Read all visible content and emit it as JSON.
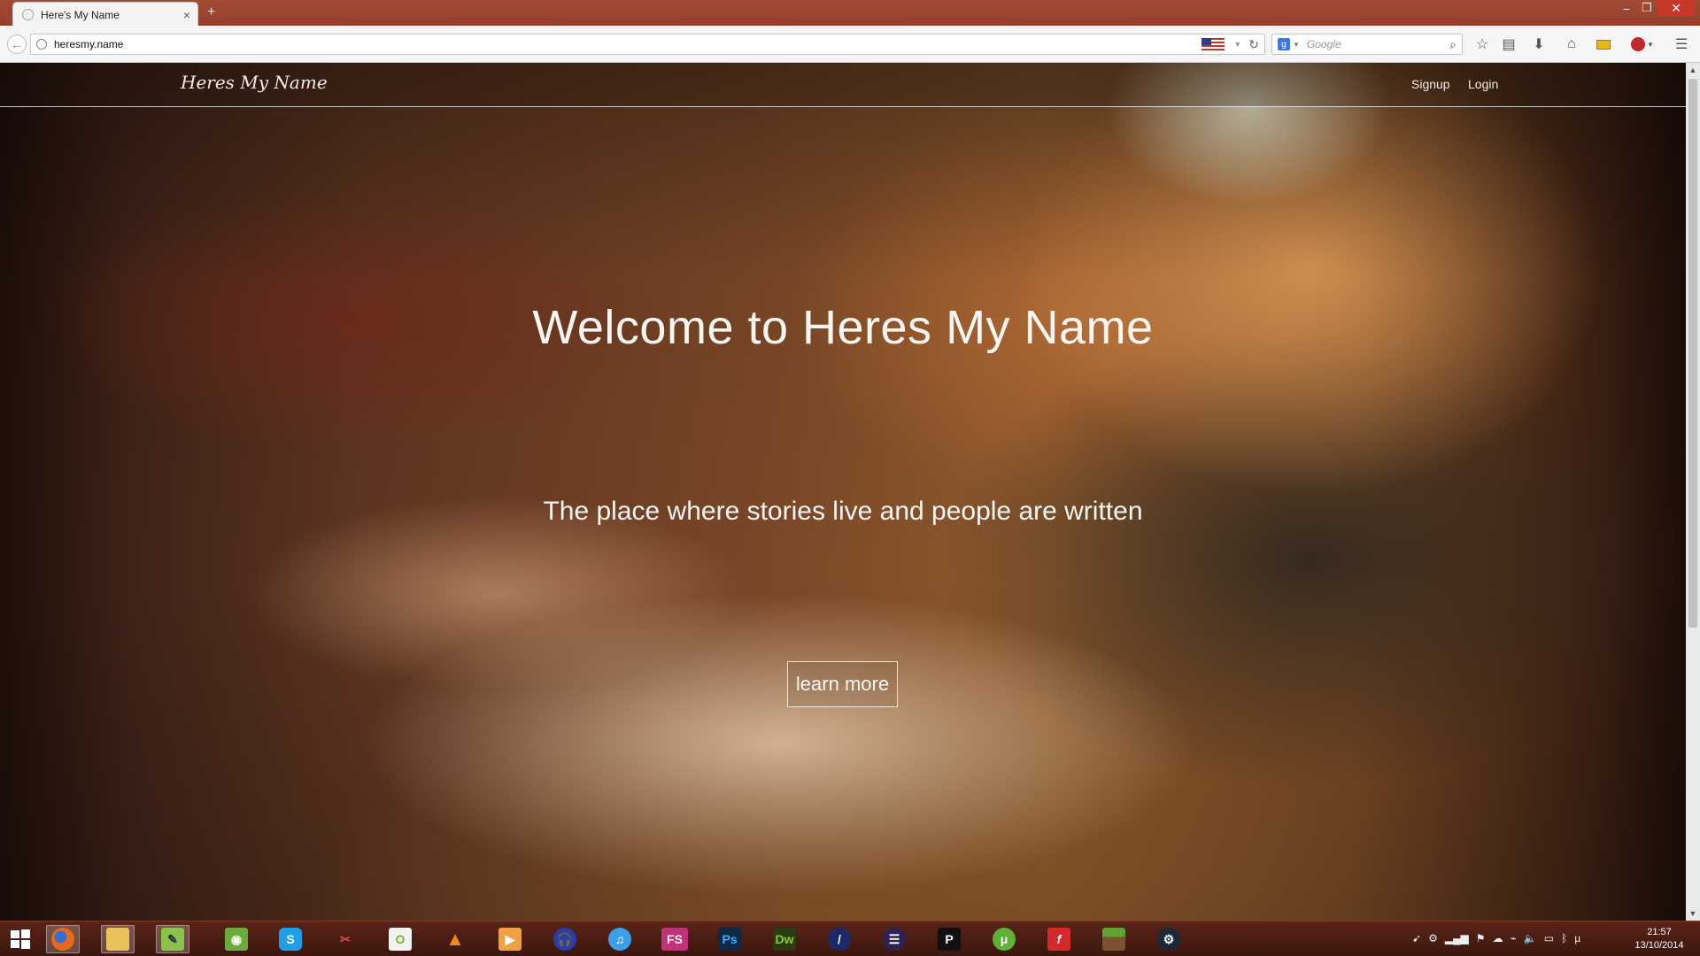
{
  "browser": {
    "tab_title": "Here's My Name",
    "tab_close": "×",
    "new_tab": "+",
    "url": "heresmy.name",
    "search_placeholder": "Google",
    "window_controls": {
      "minimize": "–",
      "maximize": "❐",
      "close": "✕"
    },
    "toolbar_icons": [
      "back-icon",
      "star-icon",
      "reading-list-icon",
      "download-icon",
      "home-icon",
      "addon-icon",
      "abp-icon",
      "menu-icon"
    ]
  },
  "site": {
    "brand": "Heres My Name",
    "nav": {
      "signup": "Signup",
      "login": "Login"
    },
    "hero": {
      "title": "Welcome to Heres My Name",
      "subtitle": "The place where stories live and people are written",
      "button": "learn more"
    }
  },
  "taskbar": {
    "apps": [
      {
        "name": "firefox",
        "label": ""
      },
      {
        "name": "file-explorer",
        "label": ""
      },
      {
        "name": "notepad",
        "label": ""
      },
      {
        "name": "evernote",
        "label": ""
      },
      {
        "name": "skype",
        "label": "S"
      },
      {
        "name": "snipping-tool",
        "label": ""
      },
      {
        "name": "origin",
        "label": "O"
      },
      {
        "name": "vlc",
        "label": ""
      },
      {
        "name": "media-player",
        "label": ""
      },
      {
        "name": "audio-app",
        "label": ""
      },
      {
        "name": "itunes",
        "label": ""
      },
      {
        "name": "fs-app",
        "label": "FS"
      },
      {
        "name": "photoshop",
        "label": "Ps"
      },
      {
        "name": "dreamweaver",
        "label": "Dw"
      },
      {
        "name": "eclipse-app",
        "label": ""
      },
      {
        "name": "eclipse-ide",
        "label": ""
      },
      {
        "name": "p-app",
        "label": "P"
      },
      {
        "name": "utorrent",
        "label": "μ"
      },
      {
        "name": "flash",
        "label": "f"
      },
      {
        "name": "minecraft",
        "label": ""
      },
      {
        "name": "steam",
        "label": ""
      }
    ],
    "clock": {
      "time": "21:57",
      "date": "13/10/2014"
    }
  },
  "colors": {
    "title_bar": "#a14a34",
    "taskbar": "#4a1c12",
    "close_button": "#c7382b"
  }
}
